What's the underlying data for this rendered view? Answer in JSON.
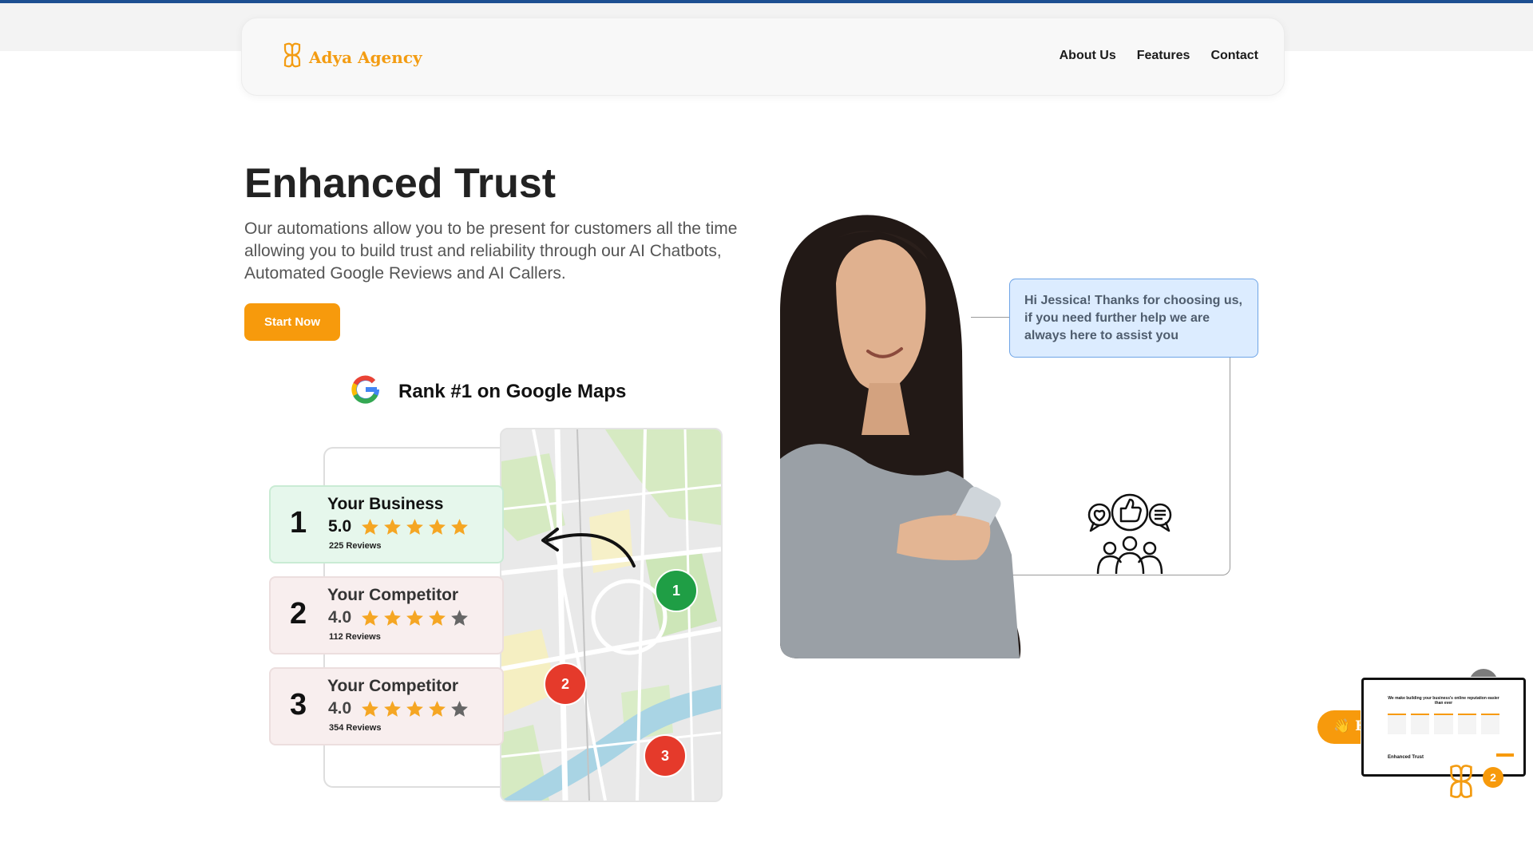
{
  "nav": {
    "brand_name": "Adya Agency",
    "links": [
      {
        "label": "About Us"
      },
      {
        "label": "Features"
      },
      {
        "label": "Contact"
      }
    ]
  },
  "hero": {
    "title": "Enhanced Trust",
    "description": "Our automations allow you to be present for customers all the time allowing you to build trust and reliability through our AI Chatbots, Automated Google Reviews and AI Callers.",
    "cta_label": "Start Now"
  },
  "google_graphic": {
    "title": "Rank #1 on Google Maps",
    "rankings": [
      {
        "rank": "1",
        "name": "Your Business",
        "score": "5.0",
        "stars_filled": 5,
        "reviews": "225 Reviews"
      },
      {
        "rank": "2",
        "name": "Your Competitor",
        "score": "4.0",
        "stars_filled": 4,
        "reviews": "112 Reviews"
      },
      {
        "rank": "3",
        "name": "Your Competitor",
        "score": "4.0",
        "stars_filled": 4,
        "reviews": "354 Reviews"
      }
    ],
    "map_pins": [
      "1",
      "2",
      "3"
    ]
  },
  "chat_bubble": {
    "text": "Hi Jessica! Thanks for choosing us, if you need further help we are always here to assist you"
  },
  "widget": {
    "pill_label": "👋 Hi",
    "notification_count": "2",
    "preview_heading": "We make building your business's online reputation easier than ever",
    "preview_section_title": "Enhanced Trust"
  },
  "colors": {
    "brand_orange": "#f79a0c",
    "top_bar": "#1d4f91",
    "pin_green": "#1f9e45",
    "pin_red": "#e53a2b",
    "bubble_bg": "#dcecff",
    "star": "#f5a623",
    "star_empty": "#666666"
  },
  "icons": [
    "adya-logo-icon",
    "google-g-icon",
    "star-icon",
    "curved-arrow-icon",
    "community-feedback-icon",
    "close-icon"
  ]
}
